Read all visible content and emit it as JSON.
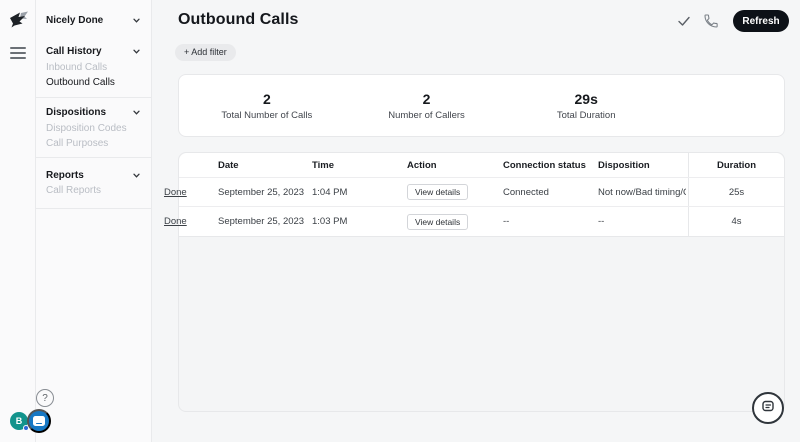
{
  "sidebar": {
    "account": {
      "name": "Nicely Done"
    },
    "sections": [
      {
        "title": "Call History",
        "items": [
          {
            "label": "Inbound Calls",
            "active": false
          },
          {
            "label": "Outbound Calls",
            "active": true
          }
        ]
      },
      {
        "title": "Dispositions",
        "items": [
          {
            "label": "Disposition Codes",
            "active": false
          },
          {
            "label": "Call Purposes",
            "active": false
          }
        ]
      },
      {
        "title": "Reports",
        "items": [
          {
            "label": "Call Reports",
            "active": false
          }
        ]
      }
    ]
  },
  "header": {
    "title": "Outbound Calls",
    "refresh_label": "Refresh"
  },
  "filters": {
    "add_filter_label": "+ Add filter"
  },
  "stats": [
    {
      "value": "2",
      "label": "Total Number of Calls"
    },
    {
      "value": "2",
      "label": "Number of Callers"
    },
    {
      "value": "29s",
      "label": "Total Duration"
    }
  ],
  "table": {
    "columns": [
      "Date",
      "Time",
      "Action",
      "Connection status",
      "Disposition",
      "Duration"
    ],
    "rows": [
      {
        "link": "Done",
        "date": "September 25, 2023",
        "time": "1:04 PM",
        "action": "View details",
        "connection_status": "Connected",
        "disposition": "Not now/Bad timing/C...",
        "duration": "25s"
      },
      {
        "link": "Done",
        "date": "September 25, 2023",
        "time": "1:03 PM",
        "action": "View details",
        "connection_status": "--",
        "disposition": "--",
        "duration": "4s"
      }
    ]
  },
  "widgets": {
    "help_label": "?",
    "chat_badge_letter": "B"
  },
  "colors": {
    "refresh_button": "#0d1117",
    "launcher_blue": "#1778c4",
    "badge_teal": "#12938c",
    "page_background": "#f5f6f7",
    "sidebar_background": "#fafafb"
  }
}
